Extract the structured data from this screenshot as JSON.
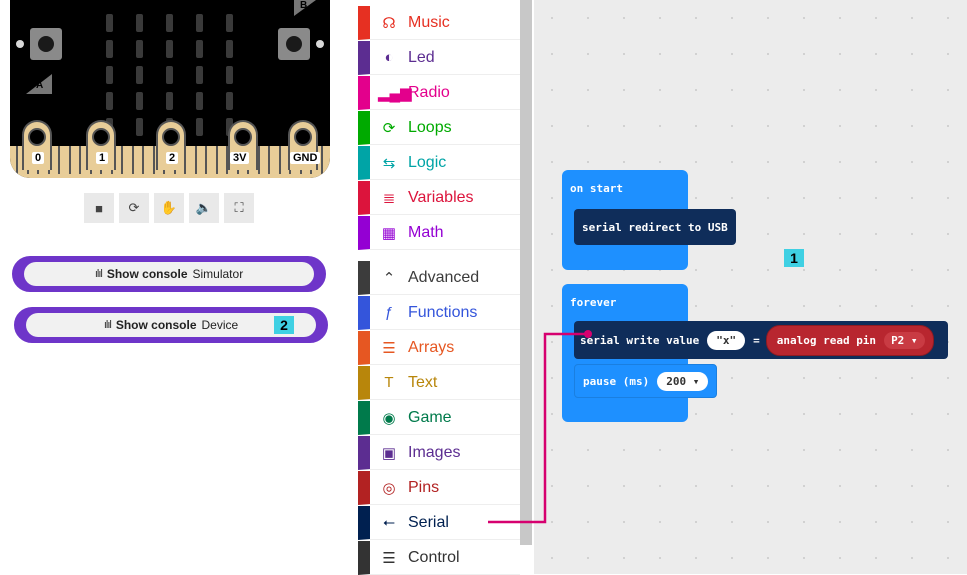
{
  "simulator": {
    "button_a_label": "A",
    "button_b_label": "B",
    "pins": [
      "0",
      "1",
      "2",
      "3V",
      "GND"
    ],
    "controls": [
      {
        "name": "stop-icon",
        "glyph": "■"
      },
      {
        "name": "restart-icon",
        "glyph": "⟳"
      },
      {
        "name": "debug-icon",
        "glyph": "✋"
      },
      {
        "name": "mute-icon",
        "glyph": "🔈"
      },
      {
        "name": "fullscreen-icon",
        "glyph": "⛶"
      }
    ]
  },
  "console_buttons": [
    {
      "bars": "ılıl",
      "label": "Show console",
      "target": "Simulator"
    },
    {
      "bars": "ılıl",
      "label": "Show console",
      "target": "Device",
      "badge": "2"
    }
  ],
  "toolbox": {
    "categories": [
      {
        "label": "Music",
        "color": "#e63022",
        "icon": "headphones-icon",
        "glyph": "☊"
      },
      {
        "label": "Led",
        "color": "#5c2d91",
        "icon": "toggle-icon",
        "glyph": "◐"
      },
      {
        "label": "Radio",
        "color": "#e3008c",
        "icon": "signal-icon",
        "glyph": "▂▄▆"
      },
      {
        "label": "Loops",
        "color": "#00aa00",
        "icon": "refresh-icon",
        "glyph": "⟳"
      },
      {
        "label": "Logic",
        "color": "#00a4a6",
        "icon": "shuffle-icon",
        "glyph": "⇆"
      },
      {
        "label": "Variables",
        "color": "#dc143c",
        "icon": "list-icon",
        "glyph": "≣"
      },
      {
        "label": "Math",
        "color": "#9400d3",
        "icon": "calculator-icon",
        "glyph": "▦"
      },
      {
        "label": "Advanced",
        "color": "#3c3c3c",
        "icon": "chevron-up-icon",
        "glyph": "⌃"
      },
      {
        "label": "Functions",
        "color": "#3455db",
        "icon": "function-icon",
        "glyph": "ƒ"
      },
      {
        "label": "Arrays",
        "color": "#e65722",
        "icon": "array-icon",
        "glyph": "☰"
      },
      {
        "label": "Text",
        "color": "#b8860b",
        "icon": "text-icon",
        "glyph": "T"
      },
      {
        "label": "Game",
        "color": "#007a4b",
        "icon": "gamepad-icon",
        "glyph": "◉"
      },
      {
        "label": "Images",
        "color": "#5c2d91",
        "icon": "image-icon",
        "glyph": "▣"
      },
      {
        "label": "Pins",
        "color": "#b22222",
        "icon": "target-icon",
        "glyph": "◎"
      },
      {
        "label": "Serial",
        "color": "#002050",
        "icon": "usb-icon",
        "glyph": "⭠"
      },
      {
        "label": "Control",
        "color": "#333333",
        "icon": "server-icon",
        "glyph": "☰"
      }
    ]
  },
  "workspace": {
    "on_start": {
      "label": "on start",
      "inner": "serial redirect to USB"
    },
    "forever": {
      "label": "forever",
      "write": {
        "label": "serial write value",
        "name_value": "\"x\"",
        "equals": "=",
        "analog": "analog read pin",
        "pin": "P2 ▾"
      },
      "pause": {
        "label": "pause (ms)",
        "value": "200 ▾"
      }
    },
    "badge": "1"
  },
  "colors": {
    "console_border": "#6e35c9",
    "badge": "#3fd0e3",
    "connector": "#d6006f"
  }
}
